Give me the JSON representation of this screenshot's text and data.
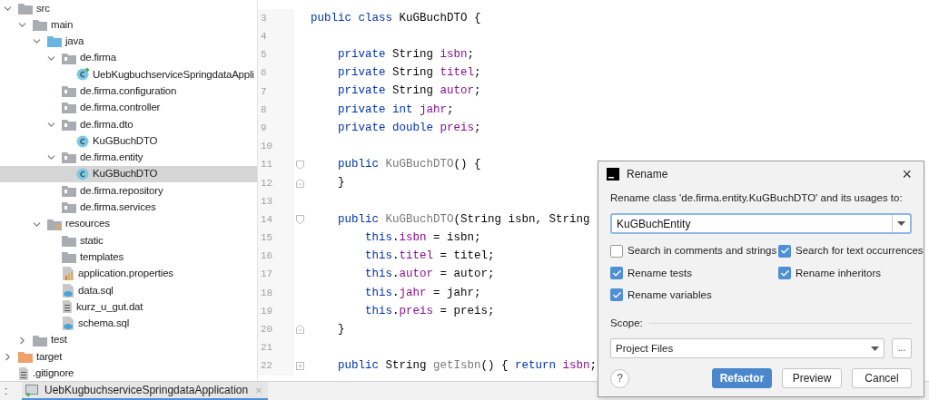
{
  "project_tree": [
    {
      "label": "src",
      "kind": "folder",
      "expanded": true,
      "selected": false,
      "children": [
        {
          "label": "main",
          "kind": "folder",
          "expanded": true,
          "selected": false,
          "children": [
            {
              "label": "java",
              "kind": "source-folder",
              "expanded": true,
              "selected": false,
              "children": [
                {
                  "label": "de.firma",
                  "kind": "package",
                  "expanded": true,
                  "selected": false,
                  "children": [
                    {
                      "label": "UebKugbuchserviceSpringdataAppli",
                      "kind": "app-class",
                      "selected": false
                    }
                  ]
                },
                {
                  "label": "de.firma.configuration",
                  "kind": "package",
                  "selected": false
                },
                {
                  "label": "de.firma.controller",
                  "kind": "package",
                  "selected": false
                },
                {
                  "label": "de.firma.dto",
                  "kind": "package",
                  "expanded": true,
                  "selected": false,
                  "children": [
                    {
                      "label": "KuGBuchDTO",
                      "kind": "class",
                      "selected": false
                    }
                  ]
                },
                {
                  "label": "de.firma.entity",
                  "kind": "package",
                  "expanded": true,
                  "selected": false,
                  "children": [
                    {
                      "label": "KuGBuchDTO",
                      "kind": "class",
                      "selected": true
                    }
                  ]
                },
                {
                  "label": "de.firma.repository",
                  "kind": "package",
                  "selected": false
                },
                {
                  "label": "de.firma.services",
                  "kind": "package",
                  "selected": false
                }
              ]
            },
            {
              "label": "resources",
              "kind": "resources-folder",
              "expanded": true,
              "selected": false,
              "children": [
                {
                  "label": "static",
                  "kind": "folder",
                  "selected": false
                },
                {
                  "label": "templates",
                  "kind": "folder",
                  "selected": false
                },
                {
                  "label": "application.properties",
                  "kind": "properties",
                  "selected": false
                },
                {
                  "label": "data.sql",
                  "kind": "sql",
                  "selected": false
                },
                {
                  "label": "kurz_u_gut.dat",
                  "kind": "text-file",
                  "selected": false
                },
                {
                  "label": "schema.sql",
                  "kind": "sql",
                  "selected": false
                }
              ]
            }
          ]
        },
        {
          "label": "test",
          "kind": "folder",
          "expanded": false,
          "selected": false
        }
      ]
    },
    {
      "label": "target",
      "kind": "excluded-folder",
      "expanded": false,
      "selected": false
    },
    {
      "label": ".gitignore",
      "kind": "text-file",
      "selected": false
    }
  ],
  "editor": {
    "lines": [
      {
        "number": "3",
        "kind": "plain",
        "tokens": [
          {
            "text": "public class ",
            "kind": "keyword"
          },
          {
            "text": "KuGBuchDTO",
            "kind": "plain"
          },
          {
            "text": " {",
            "kind": "plain"
          }
        ]
      },
      {
        "number": "4",
        "kind": "plain"
      },
      {
        "number": "5",
        "kind": "plain",
        "tokens": [
          {
            "text": "    private ",
            "kind": "keyword"
          },
          {
            "text": "String ",
            "kind": "plain"
          },
          {
            "text": "isbn",
            "kind": "field"
          },
          {
            "text": ";",
            "kind": "plain"
          }
        ]
      },
      {
        "number": "6",
        "kind": "plain",
        "tokens": [
          {
            "text": "    private ",
            "kind": "keyword"
          },
          {
            "text": "String ",
            "kind": "plain"
          },
          {
            "text": "titel",
            "kind": "field"
          },
          {
            "text": ";",
            "kind": "plain"
          }
        ]
      },
      {
        "number": "7",
        "kind": "plain",
        "tokens": [
          {
            "text": "    private ",
            "kind": "keyword"
          },
          {
            "text": "String ",
            "kind": "plain"
          },
          {
            "text": "autor",
            "kind": "field"
          },
          {
            "text": ";",
            "kind": "plain"
          }
        ]
      },
      {
        "number": "8",
        "kind": "plain",
        "tokens": [
          {
            "text": "    private int ",
            "kind": "keyword"
          },
          {
            "text": "jahr",
            "kind": "field"
          },
          {
            "text": ";",
            "kind": "plain"
          }
        ]
      },
      {
        "number": "9",
        "kind": "plain",
        "tokens": [
          {
            "text": "    private double ",
            "kind": "keyword"
          },
          {
            "text": "preis",
            "kind": "field"
          },
          {
            "text": ";",
            "kind": "plain"
          }
        ]
      },
      {
        "number": "10",
        "kind": "plain"
      },
      {
        "number": "11",
        "kind": "fold-start",
        "tokens": [
          {
            "text": "    public ",
            "kind": "keyword"
          },
          {
            "text": "KuGBuchDTO",
            "kind": "unused"
          },
          {
            "text": "() {",
            "kind": "plain"
          }
        ]
      },
      {
        "number": "12",
        "kind": "fold-end",
        "tokens": [
          {
            "text": "    }",
            "kind": "plain"
          }
        ]
      },
      {
        "number": "13",
        "kind": "plain"
      },
      {
        "number": "14",
        "kind": "fold-start",
        "tokens": [
          {
            "text": "    public ",
            "kind": "keyword"
          },
          {
            "text": "KuGBuchDTO",
            "kind": "unused"
          },
          {
            "text": "(String isbn, String",
            "kind": "plain"
          }
        ]
      },
      {
        "number": "15",
        "kind": "plain",
        "tokens": [
          {
            "text": "        this",
            "kind": "keyword"
          },
          {
            "text": ".",
            "kind": "plain"
          },
          {
            "text": "isbn",
            "kind": "field"
          },
          {
            "text": " = isbn;",
            "kind": "plain"
          }
        ]
      },
      {
        "number": "16",
        "kind": "plain",
        "tokens": [
          {
            "text": "        this",
            "kind": "keyword"
          },
          {
            "text": ".",
            "kind": "plain"
          },
          {
            "text": "titel",
            "kind": "field"
          },
          {
            "text": " = titel;",
            "kind": "plain"
          }
        ]
      },
      {
        "number": "17",
        "kind": "plain",
        "tokens": [
          {
            "text": "        this",
            "kind": "keyword"
          },
          {
            "text": ".",
            "kind": "plain"
          },
          {
            "text": "autor",
            "kind": "field"
          },
          {
            "text": " = autor;",
            "kind": "plain"
          }
        ]
      },
      {
        "number": "18",
        "kind": "plain",
        "tokens": [
          {
            "text": "        this",
            "kind": "keyword"
          },
          {
            "text": ".",
            "kind": "plain"
          },
          {
            "text": "jahr",
            "kind": "field"
          },
          {
            "text": " = jahr;",
            "kind": "plain"
          }
        ]
      },
      {
        "number": "19",
        "kind": "plain",
        "tokens": [
          {
            "text": "        this",
            "kind": "keyword"
          },
          {
            "text": ".",
            "kind": "plain"
          },
          {
            "text": "preis",
            "kind": "field"
          },
          {
            "text": " = preis;",
            "kind": "plain"
          }
        ]
      },
      {
        "number": "20",
        "kind": "fold-end",
        "tokens": [
          {
            "text": "    }",
            "kind": "plain"
          }
        ]
      },
      {
        "number": "21",
        "kind": "plain"
      },
      {
        "number": "22",
        "kind": "fold-collapsed",
        "tokens": [
          {
            "text": "    public ",
            "kind": "keyword"
          },
          {
            "text": "String ",
            "kind": "plain"
          },
          {
            "text": "getIsbn",
            "kind": "unused"
          },
          {
            "text": "() { ",
            "kind": "plain"
          },
          {
            "text": "return ",
            "kind": "keyword"
          },
          {
            "text": "isbn",
            "kind": "field"
          },
          {
            "text": ";",
            "kind": "plain"
          }
        ]
      }
    ]
  },
  "run_bar": {
    "prefix": ":",
    "tab": "UebKugbuchserviceSpringdataApplication",
    "close": "×"
  },
  "rename_dialog": {
    "title": "Rename",
    "close": "×",
    "prompt": "Rename class 'de.firma.entity.KuGBuchDTO' and its usages to:",
    "value": "KuGBuchEntity",
    "options": [
      {
        "label": "Search in comments and strings",
        "checked": false
      },
      {
        "label": "Search for text occurrences",
        "checked": true
      },
      {
        "label": "Rename tests",
        "checked": true
      },
      {
        "label": "Rename inheritors",
        "checked": true
      },
      {
        "label": "Rename variables",
        "checked": true
      }
    ],
    "scope_label": "Scope:",
    "scope": "Project Files",
    "more": "...",
    "help": "?",
    "buttons": [
      {
        "label": "Refactor",
        "kind": "primary"
      },
      {
        "label": "Preview",
        "kind": "secondary"
      },
      {
        "label": "Cancel",
        "kind": "secondary"
      }
    ]
  }
}
